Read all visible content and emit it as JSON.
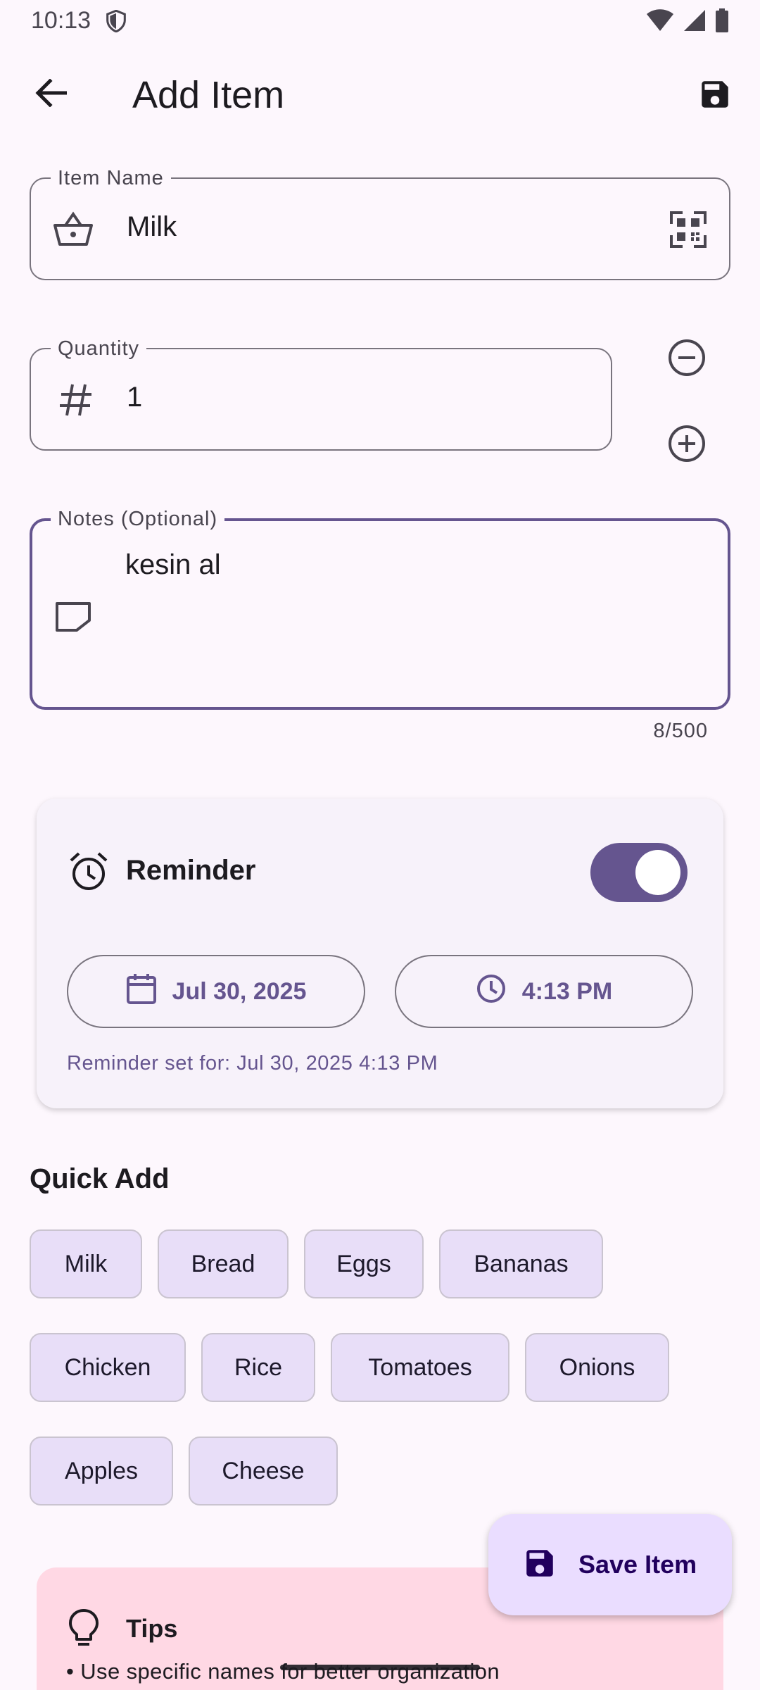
{
  "status_bar": {
    "time": "10:13"
  },
  "app_bar": {
    "title": "Add Item"
  },
  "item_name": {
    "label": "Item Name",
    "value": "Milk"
  },
  "quantity": {
    "label": "Quantity",
    "value": "1"
  },
  "notes": {
    "label": "Notes (Optional)",
    "value": "kesin al",
    "counter": "8/500"
  },
  "reminder": {
    "title": "Reminder",
    "enabled": true,
    "date": "Jul 30, 2025",
    "time": "4:13 PM",
    "note": "Reminder set for: Jul 30, 2025 4:13 PM"
  },
  "quick_add": {
    "title": "Quick Add",
    "items": [
      "Milk",
      "Bread",
      "Eggs",
      "Bananas",
      "Chicken",
      "Rice",
      "Tomatoes",
      "Onions",
      "Apples",
      "Cheese"
    ]
  },
  "tips": {
    "title": "Tips",
    "line": "• Use specific names for better organization"
  },
  "fab": {
    "label": "Save Item"
  },
  "colors": {
    "primary": "#65558F",
    "background": "#FDF7FD",
    "chip": "#E8DEF8",
    "tips_bg": "#FFD8E4",
    "fab_bg": "#EADDFF"
  },
  "icons": [
    "back-arrow-icon",
    "save-icon",
    "basket-icon",
    "qr-scan-icon",
    "hash-icon",
    "minus-circle-icon",
    "plus-circle-icon",
    "note-icon",
    "alarm-icon",
    "calendar-icon",
    "clock-icon",
    "lightbulb-icon"
  ]
}
